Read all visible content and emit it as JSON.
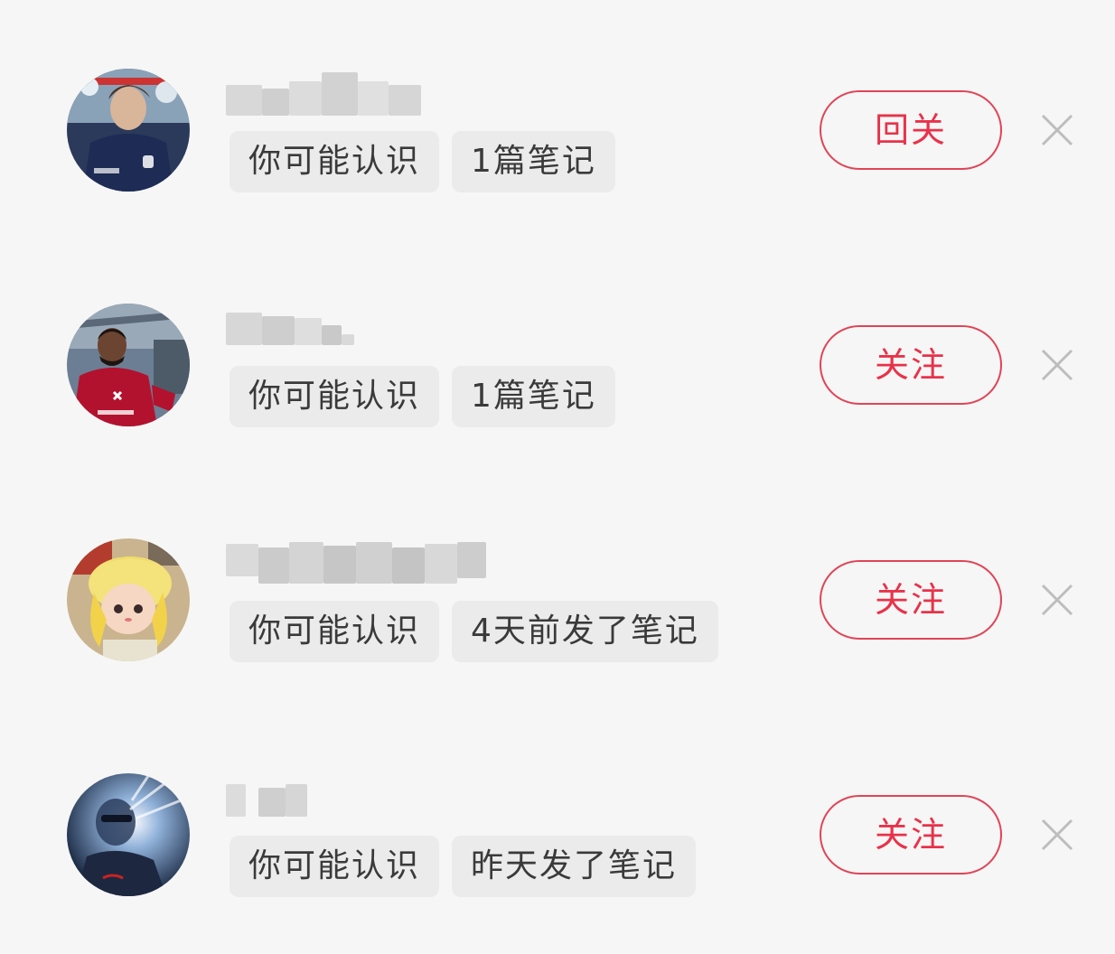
{
  "colors": {
    "accent": "#e8324a",
    "background": "#f6f6f6",
    "tag_bg": "#ebebeb",
    "tag_text": "#3a3a3a",
    "close_icon": "#bdbdbd"
  },
  "suggestions": [
    {
      "avatar_icon": "avatar-footballer-navy-jacket",
      "tags": [
        "你可能认识",
        "1篇笔记"
      ],
      "button_label": "回关"
    },
    {
      "avatar_icon": "avatar-footballer-red-kit",
      "tags": [
        "你可能认识",
        "1篇笔记"
      ],
      "button_label": "关注"
    },
    {
      "avatar_icon": "avatar-plush-doll",
      "tags": [
        "你可能认识",
        "4天前发了笔记"
      ],
      "button_label": "关注"
    },
    {
      "avatar_icon": "avatar-dark-selfie",
      "tags": [
        "你可能认识",
        "昨天发了笔记"
      ],
      "button_label": "关注"
    }
  ]
}
